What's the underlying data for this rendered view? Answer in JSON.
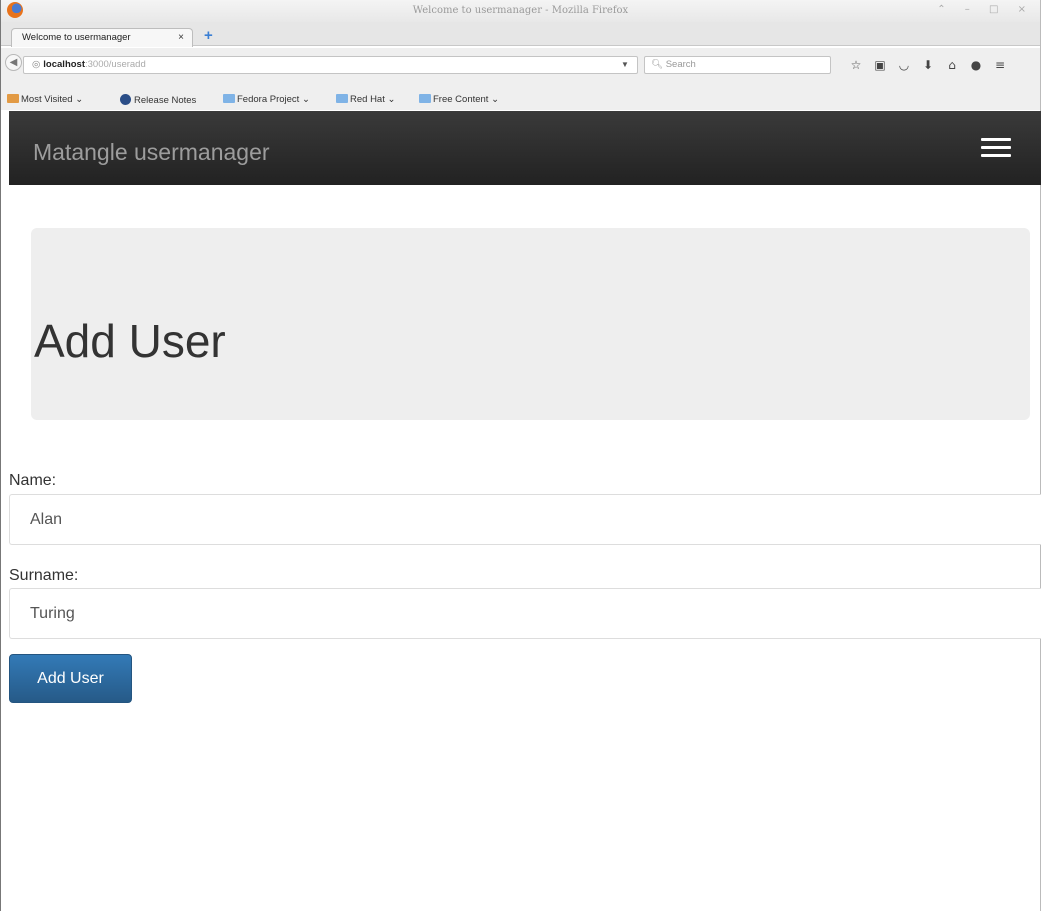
{
  "window": {
    "title": "Welcome to usermanager - Mozilla Firefox",
    "controls": "⌃ – □ ×"
  },
  "tab": {
    "title": "Welcome to usermanager",
    "close": "×",
    "new_tab": "+"
  },
  "address_bar": {
    "host": "localhost",
    "path": ":3000/useradd",
    "search_placeholder": "Search"
  },
  "bookmarks": [
    {
      "label": "Most Visited",
      "icon": "folder-orange-icon"
    },
    {
      "label": "Release Notes",
      "icon": "fedora-icon"
    },
    {
      "label": "Fedora Project",
      "icon": "folder-icon"
    },
    {
      "label": "Red Hat",
      "icon": "folder-icon"
    },
    {
      "label": "Free Content",
      "icon": "folder-icon"
    }
  ],
  "app": {
    "brand": "Matangle usermanager"
  },
  "page": {
    "title": "Add User"
  },
  "form": {
    "name_label": "Name:",
    "name_value": "Alan",
    "surname_label": "Surname:",
    "surname_value": "Turing",
    "submit_label": "Add User"
  },
  "colors": {
    "navbar": "#222222",
    "brand_text": "#9d9d9d",
    "button": "#337ab7",
    "jumbotron": "#eeeeee"
  }
}
